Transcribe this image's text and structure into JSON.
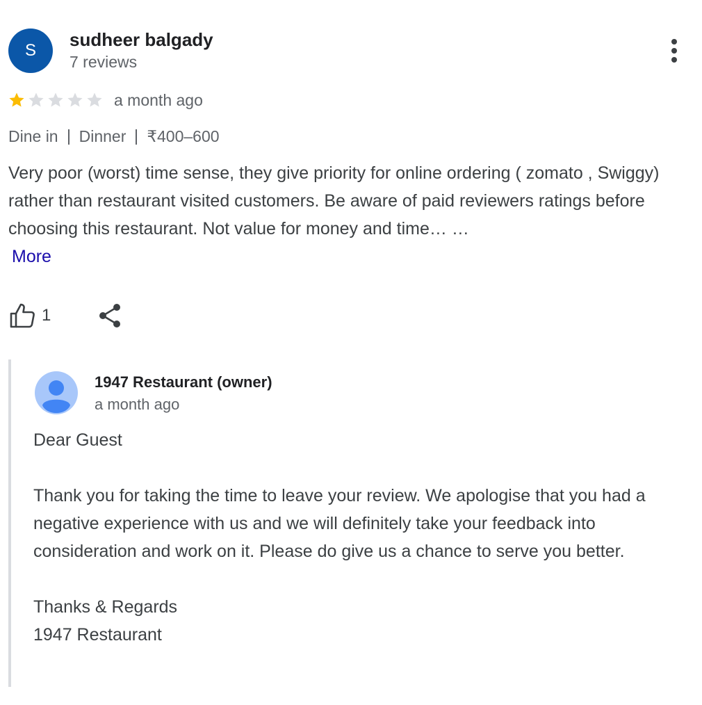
{
  "review": {
    "author_initial": "S",
    "author_name": "sudheer balgady",
    "author_reviews": "7 reviews",
    "rating": 1,
    "rating_max": 5,
    "time_ago": "a month ago",
    "meta": {
      "service": "Dine in",
      "meal": "Dinner",
      "price": "₹400–600"
    },
    "text": "Very poor (worst) time sense, they give priority for online ordering ( zomato , Swiggy) rather than restaurant visited customers. Be aware of paid reviewers ratings before choosing this restaurant. Not value for money and time… …",
    "more_label": "More",
    "like_count": "1",
    "more_menu_icon": "more-vertical-icon",
    "like_icon": "thumbs-up-icon",
    "share_icon": "share-icon"
  },
  "owner_reply": {
    "owner_name": "1947 Restaurant (owner)",
    "time_ago": "a month ago",
    "greeting": "Dear Guest",
    "body": "Thank you for taking the time to leave your review. We apologise that you had a negative experience with us and we will definitely take your feedback into consideration and work on it. Please do give us a chance to serve you better.",
    "closing": "Thanks & Regards",
    "signature": "1947 Restaurant",
    "avatar_icon": "person-avatar-icon"
  },
  "colors": {
    "avatar_bg": "#0b57a8",
    "star_filled": "#fbbc04",
    "star_empty": "#dadce0",
    "link": "#1a0dab",
    "reply_border": "#dadce0",
    "owner_avatar_bg": "#a8c7fa",
    "owner_avatar_fg": "#4285f4"
  }
}
